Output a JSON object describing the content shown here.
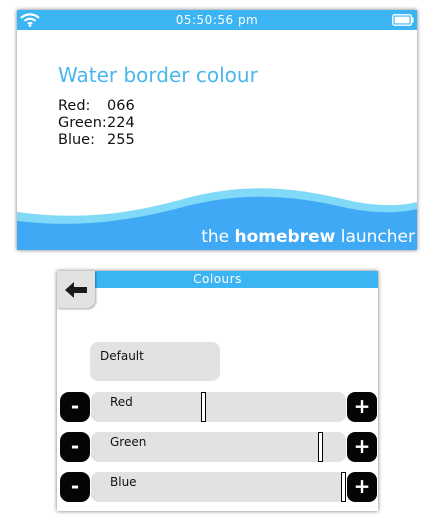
{
  "top_screen": {
    "status": {
      "time": "05:50:56 pm"
    },
    "title": "Water border colour",
    "values": [
      {
        "label": "Red:",
        "value": "066"
      },
      {
        "label": "Green:",
        "value": "224"
      },
      {
        "label": "Blue:",
        "value": "255"
      }
    ],
    "brand": {
      "prefix": "the",
      "bold": "homebrew",
      "suffix": "launcher"
    },
    "colors": {
      "accent": "#3ab4f2",
      "wave_dark": "#3fa9f5",
      "wave_light": "#7fd9f7"
    }
  },
  "bottom_screen": {
    "header_title": "Colours",
    "back_icon": "back-arrow-icon",
    "default_label": "Default",
    "sliders": [
      {
        "label": "Red",
        "value": 66,
        "max": 255,
        "minus": "-",
        "plus": "+"
      },
      {
        "label": "Green",
        "value": 224,
        "max": 255,
        "minus": "-",
        "plus": "+"
      },
      {
        "label": "Blue",
        "value": 255,
        "max": 255,
        "minus": "-",
        "plus": "+"
      }
    ]
  }
}
